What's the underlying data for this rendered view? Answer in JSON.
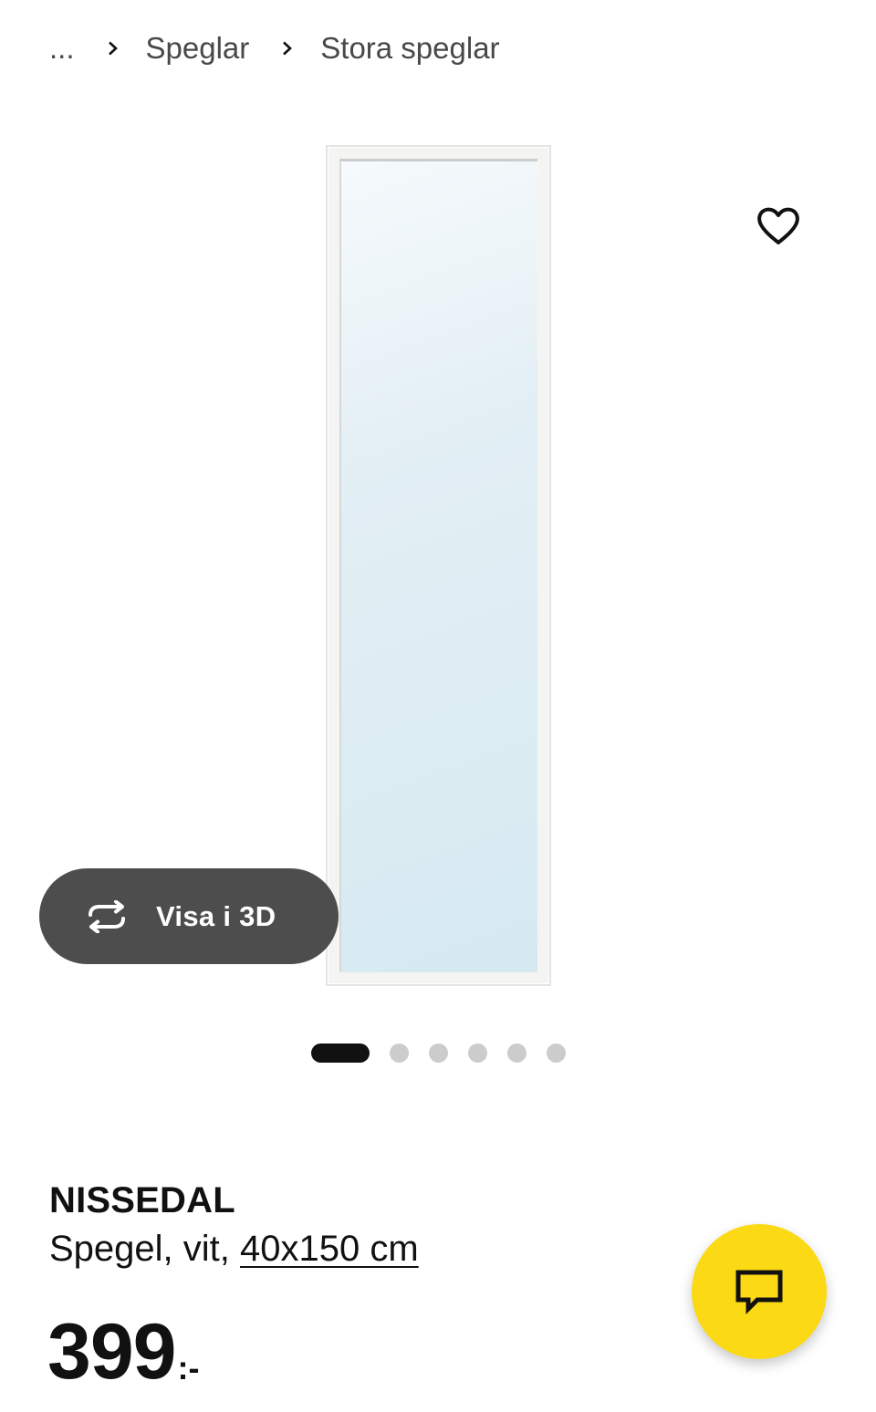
{
  "breadcrumb": {
    "ellipsis": "...",
    "items": [
      "Speglar",
      "Stora speglar"
    ]
  },
  "gallery": {
    "view_3d_label": "Visa i 3D",
    "image_count": 6,
    "active_index": 0
  },
  "product": {
    "name": "NISSEDAL",
    "description_prefix": "Spegel, vit, ",
    "size_link": "40x150 cm",
    "price_integer": "399",
    "price_suffix": ":-"
  },
  "icons": {
    "favorite": "heart-icon",
    "view_3d": "rotate-3d-icon",
    "chat": "chat-bubble-icon",
    "breadcrumb_separator": "chevron-right-icon"
  },
  "colors": {
    "chat_button": "#fbd914",
    "view_3d_button": "#4d4d4d",
    "active_dot": "#111111",
    "inactive_dot": "#cccccc"
  }
}
